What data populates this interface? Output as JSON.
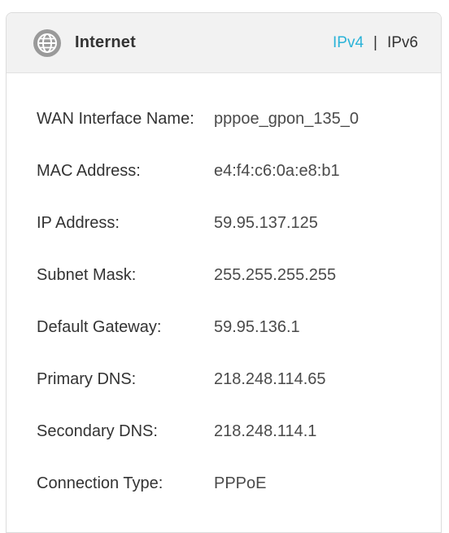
{
  "header": {
    "title": "Internet",
    "icon": "globe-icon",
    "tabs": [
      {
        "label": "IPv4",
        "active": true
      },
      {
        "label": "IPv6",
        "active": false
      }
    ],
    "tab_separator": "|",
    "accent_color": "#2bb3d8"
  },
  "rows": [
    {
      "label": "WAN Interface Name:",
      "value": "pppoe_gpon_135_0"
    },
    {
      "label": "MAC Address:",
      "value": "e4:f4:c6:0a:e8:b1"
    },
    {
      "label": "IP Address:",
      "value": "59.95.137.125"
    },
    {
      "label": "Subnet Mask:",
      "value": "255.255.255.255"
    },
    {
      "label": "Default Gateway:",
      "value": "59.95.136.1"
    },
    {
      "label": "Primary DNS:",
      "value": "218.248.114.65"
    },
    {
      "label": "Secondary DNS:",
      "value": "218.248.114.1"
    },
    {
      "label": "Connection Type:",
      "value": "PPPoE"
    }
  ]
}
